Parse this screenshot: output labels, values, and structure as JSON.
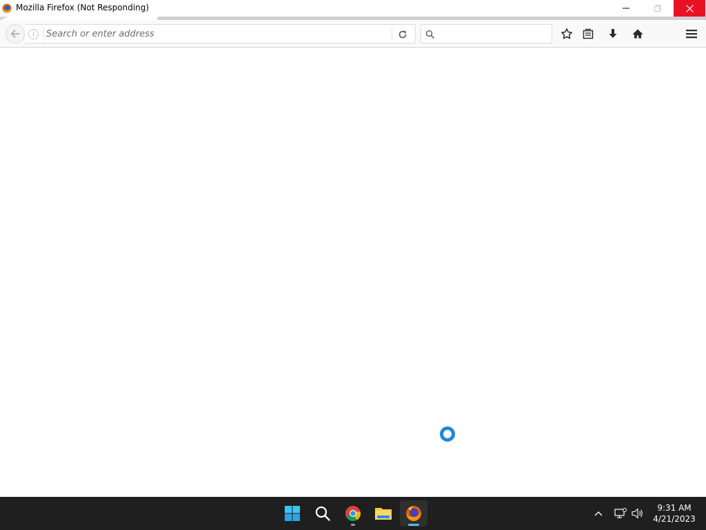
{
  "window": {
    "title": "Mozilla Firefox (Not Responding)",
    "close_color": "#e81123"
  },
  "toolbar": {
    "address_placeholder": "Search or enter address",
    "address_value": "",
    "search_placeholder": "",
    "search_value": "",
    "icons": [
      "back-icon",
      "info-icon",
      "reload-icon",
      "search-icon",
      "star-icon",
      "library-icon",
      "download-icon",
      "home-icon",
      "menu-icon"
    ]
  },
  "content": {
    "state": "blank",
    "cursor": "busy-cursor",
    "cursor_color": "#1e88d8"
  },
  "taskbar": {
    "apps": [
      {
        "name": "Start",
        "icon": "windows-start-icon"
      },
      {
        "name": "Search",
        "icon": "search-icon"
      },
      {
        "name": "Google Chrome",
        "icon": "chrome-icon",
        "running": true
      },
      {
        "name": "File Explorer",
        "icon": "folder-icon"
      },
      {
        "name": "Firefox",
        "icon": "firefox-icon",
        "active": true
      }
    ],
    "tray_icons": [
      "chevron-up-icon",
      "network-icon",
      "volume-icon"
    ],
    "time": "9:31 AM",
    "date": "4/21/2023",
    "accent": "#4cc2ff"
  }
}
